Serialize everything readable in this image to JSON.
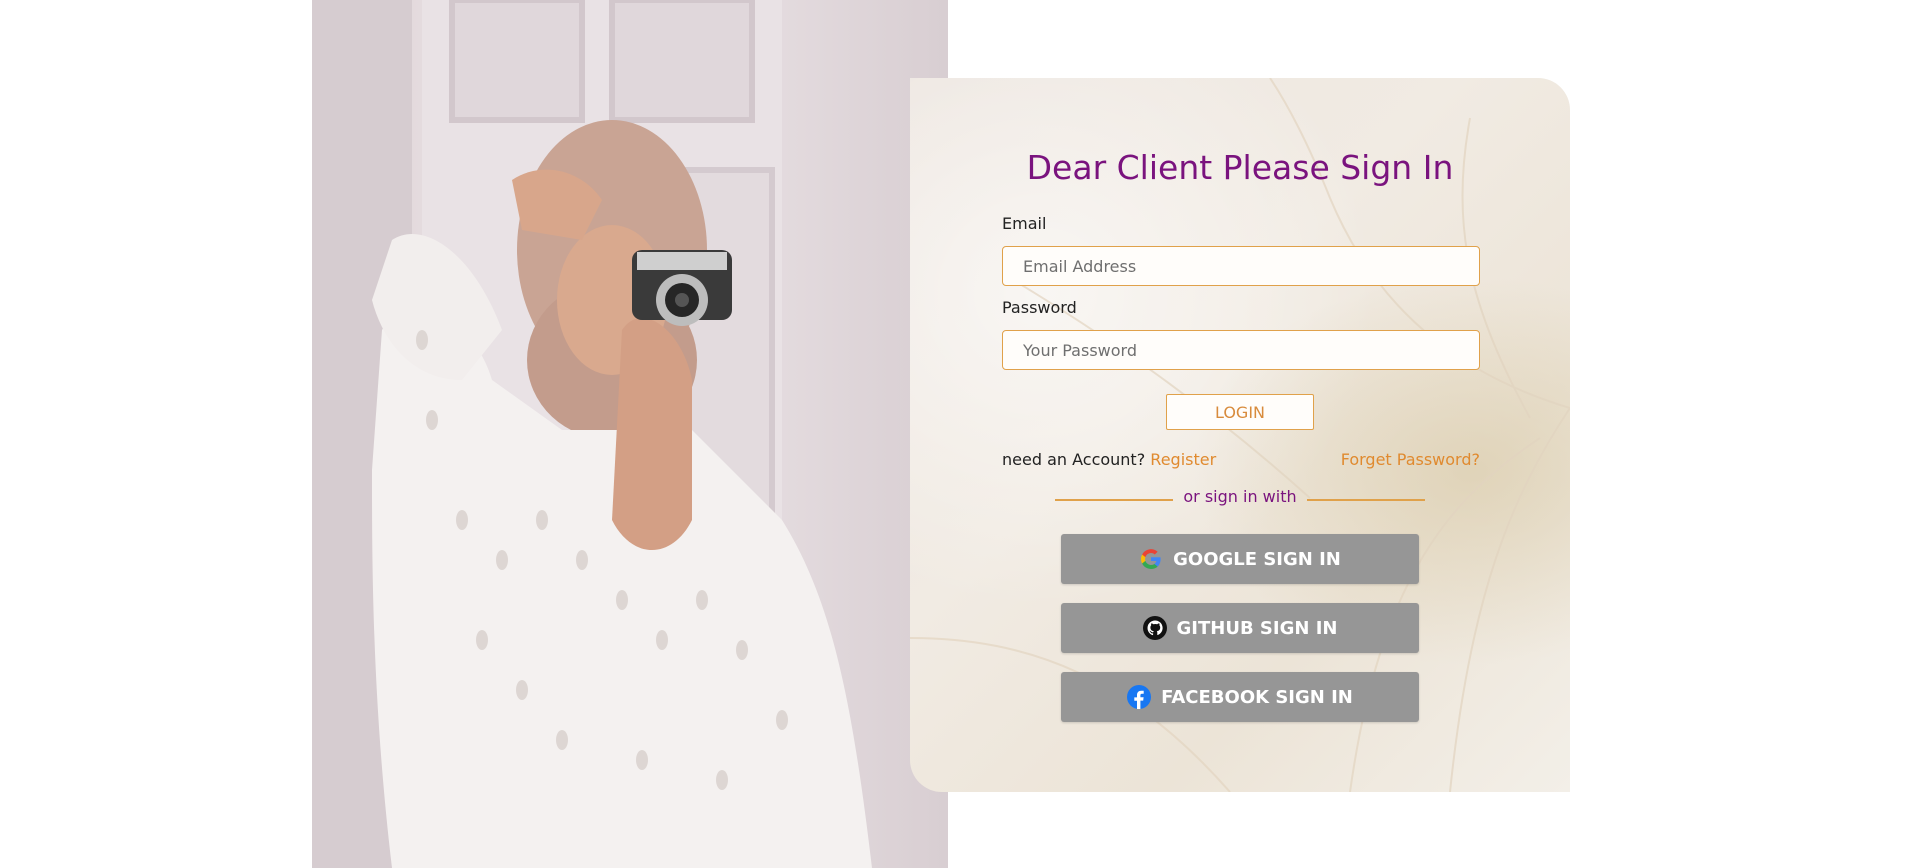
{
  "form": {
    "title": "Dear Client Please Sign In",
    "email_label": "Email",
    "email_placeholder": "Email Address",
    "email_value": "",
    "password_label": "Password",
    "password_placeholder": "Your Password",
    "password_value": "",
    "login_button": "LOGIN",
    "need_account_text": "need an Account?",
    "register_link": "Register",
    "forget_link": "Forget Password?",
    "divider_text": "or sign in with"
  },
  "social": [
    {
      "label": "GOOGLE SIGN IN",
      "icon": "google-icon"
    },
    {
      "label": "GITHUB SIGN IN",
      "icon": "github-icon"
    },
    {
      "label": "FACEBOOK SIGN IN",
      "icon": "facebook-icon"
    }
  ],
  "colors": {
    "title": "#7a137e",
    "accent": "#e0a14a",
    "link": "#e08a2f",
    "social_button": "#969696"
  },
  "photo": {
    "description_icon": "photo-woman-camera"
  }
}
